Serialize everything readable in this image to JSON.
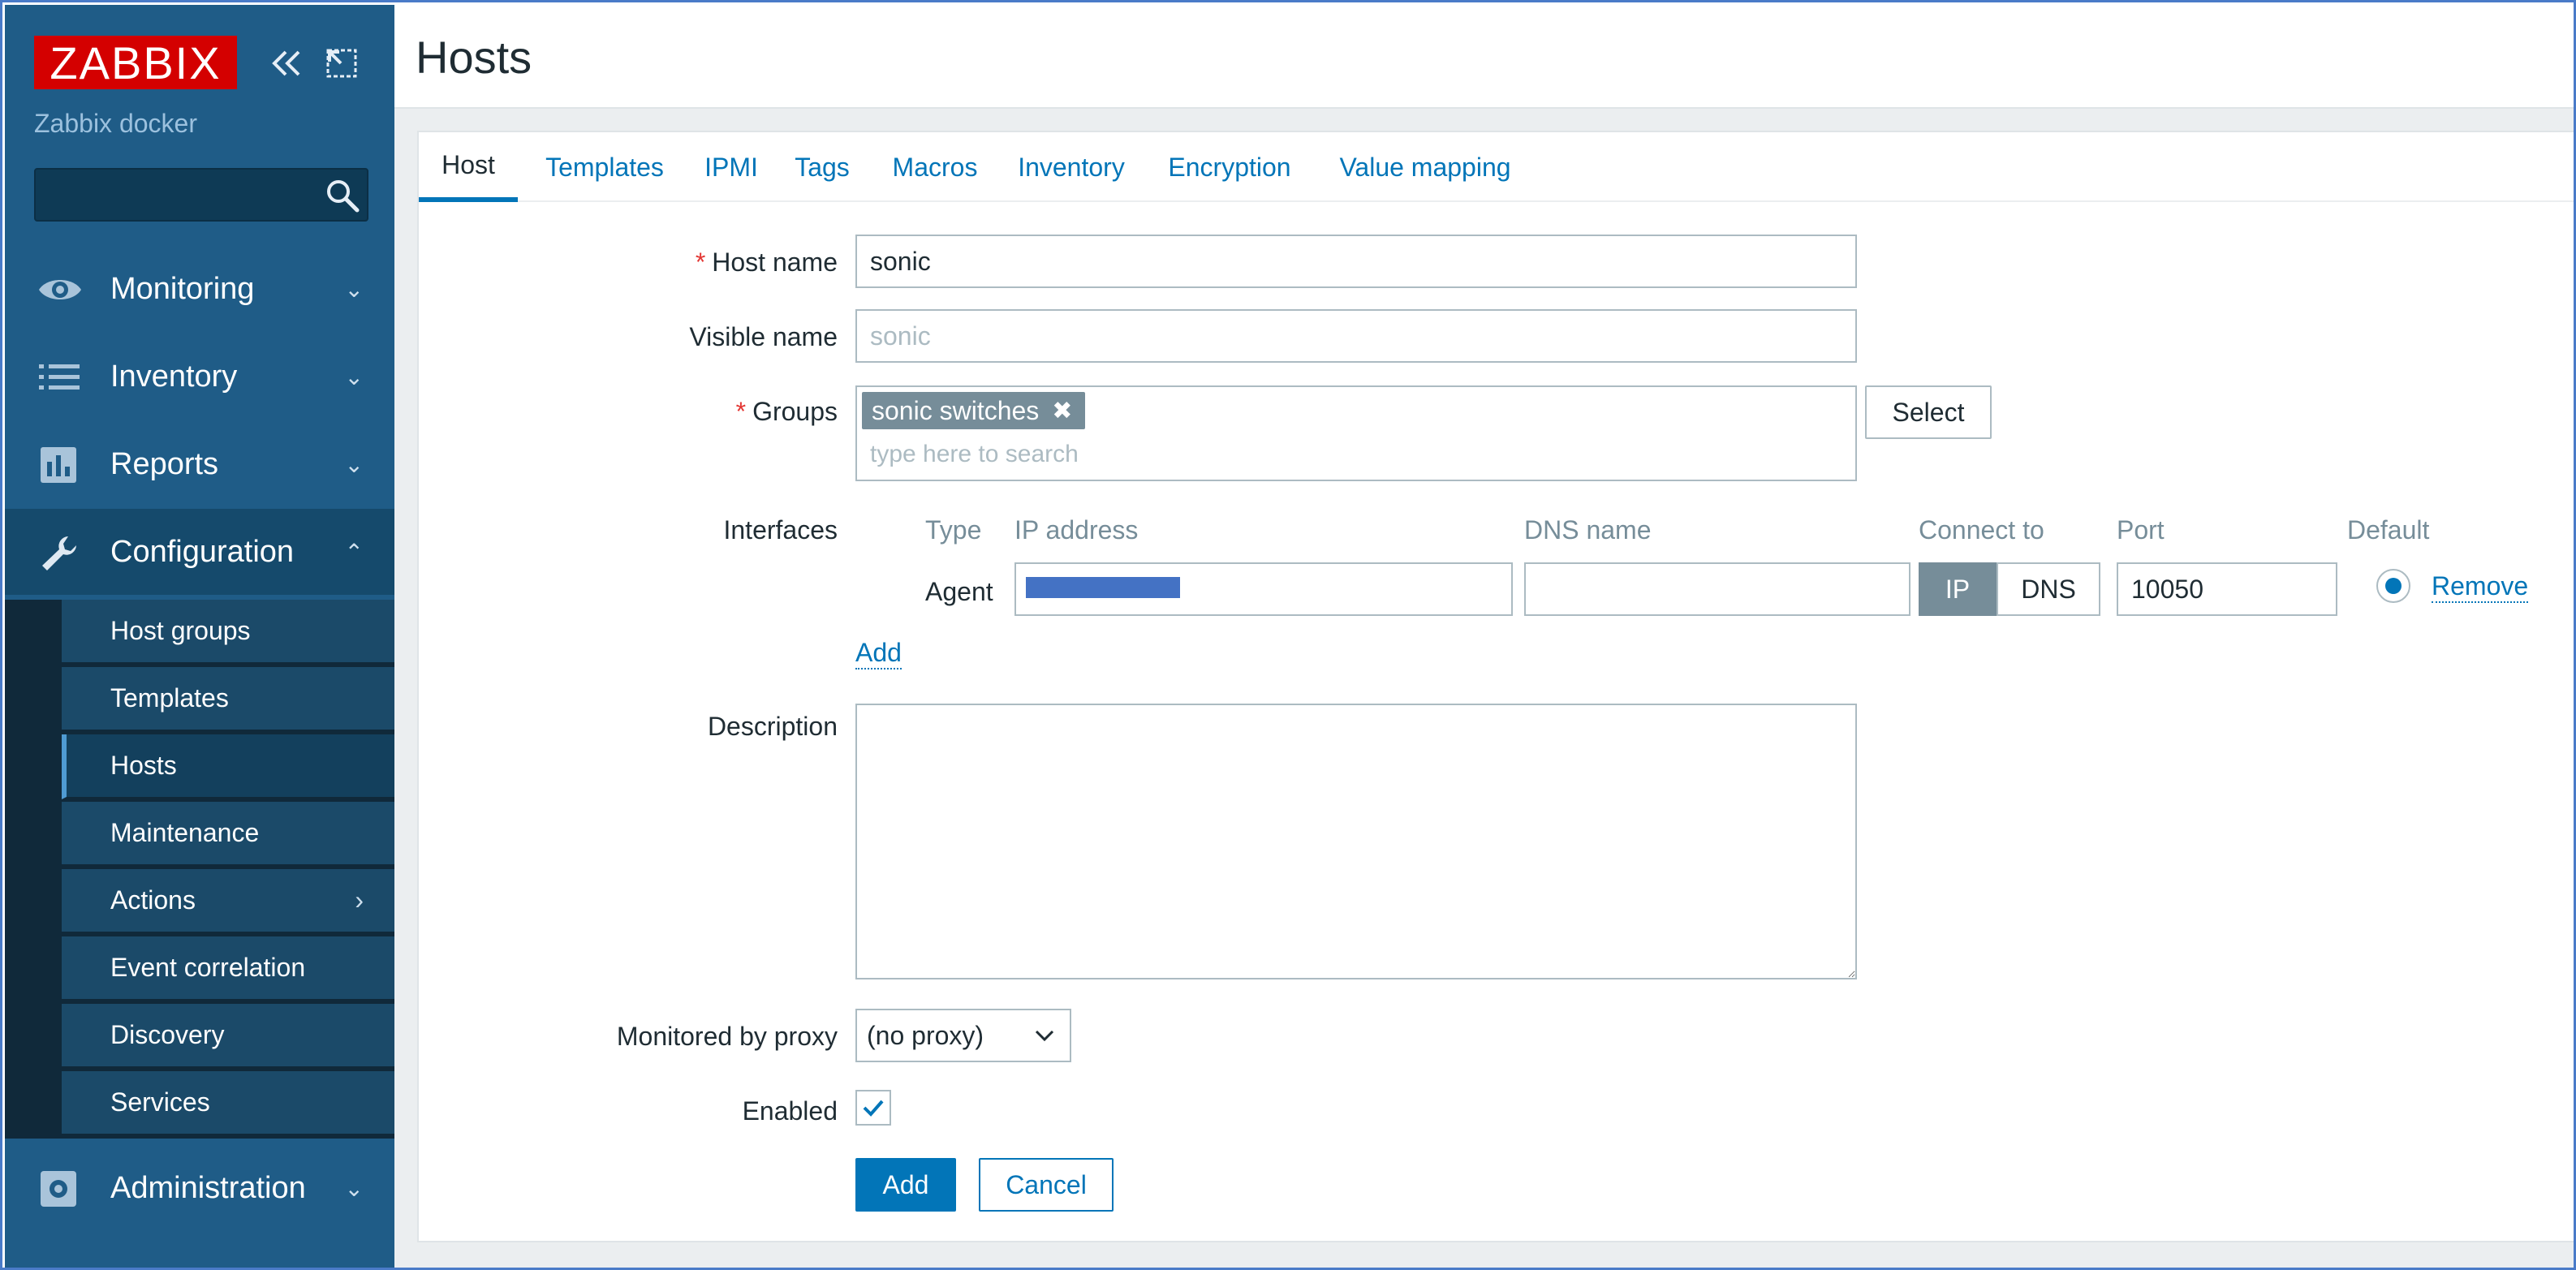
{
  "sidebar": {
    "logo": "ZABBIX",
    "server_name": "Zabbix docker",
    "search_placeholder": "",
    "menu": {
      "monitoring": "Monitoring",
      "inventory": "Inventory",
      "reports": "Reports",
      "configuration": "Configuration",
      "administration": "Administration"
    },
    "submenu": [
      "Host groups",
      "Templates",
      "Hosts",
      "Maintenance",
      "Actions",
      "Event correlation",
      "Discovery",
      "Services"
    ],
    "active_submenu": "Hosts"
  },
  "page": {
    "title": "Hosts"
  },
  "tabs": [
    "Host",
    "Templates",
    "IPMI",
    "Tags",
    "Macros",
    "Inventory",
    "Encryption",
    "Value mapping"
  ],
  "active_tab": "Host",
  "form": {
    "host_name_label": "Host name",
    "host_name_value": "sonic",
    "visible_name_label": "Visible name",
    "visible_name_placeholder": "sonic",
    "groups_label": "Groups",
    "group_chip": "sonic switches",
    "groups_placeholder": "type here to search",
    "select_label": "Select",
    "interfaces_label": "Interfaces",
    "interfaces": {
      "headers": {
        "type": "Type",
        "ip": "IP address",
        "dns": "DNS name",
        "connect": "Connect to",
        "port": "Port",
        "default": "Default"
      },
      "row": {
        "type": "Agent",
        "ip": "",
        "dns": "",
        "connect_ip": "IP",
        "connect_dns": "DNS",
        "port": "10050",
        "remove": "Remove"
      },
      "add_link": "Add"
    },
    "description_label": "Description",
    "proxy_label": "Monitored by proxy",
    "proxy_value": "(no proxy)",
    "enabled_label": "Enabled",
    "enabled": true,
    "add_button": "Add",
    "cancel_button": "Cancel"
  },
  "colors": {
    "sidebar_bg": "#1f5c87",
    "accent": "#0275b8",
    "logo_bg": "#d40000",
    "required": "#e33734"
  }
}
